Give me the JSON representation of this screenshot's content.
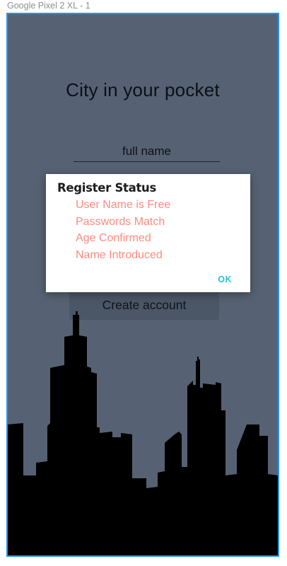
{
  "artboard": {
    "label": "Google Pixel 2 XL - 1"
  },
  "screen": {
    "title": "City in your pocket",
    "name_field": {
      "placeholder": "full name"
    },
    "create_button": "Create account",
    "colors": {
      "background": "#566273",
      "button": "#4b5667",
      "skyline": "#000000"
    }
  },
  "dialog": {
    "title": "Register Status",
    "items": [
      "User Name is Free",
      "Passwords Match",
      "Age Confirmed",
      "Name Introduced"
    ],
    "ok_label": "OK",
    "colors": {
      "item_text": "#ff8a80",
      "ok": "#20c4cf",
      "frame": "#2196f3"
    }
  }
}
